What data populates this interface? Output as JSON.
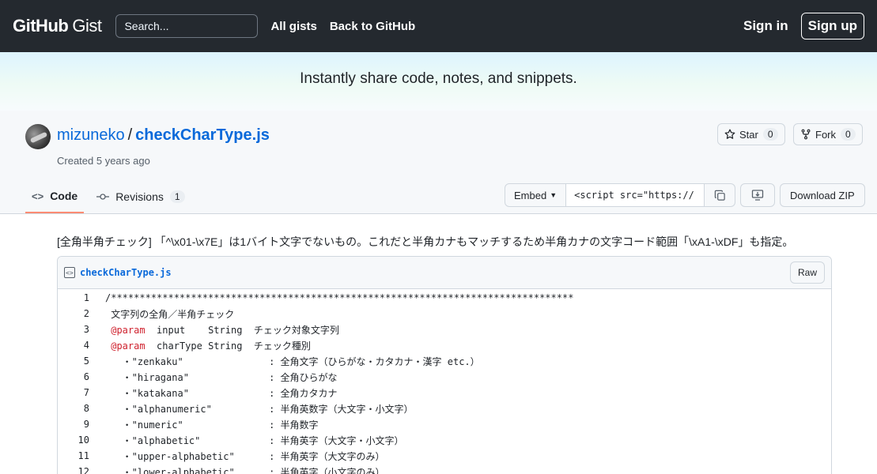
{
  "header": {
    "logo_main": "GitHub",
    "logo_sub": "Gist",
    "search_placeholder": "Search...",
    "nav": [
      "All gists",
      "Back to GitHub"
    ],
    "signin": "Sign in",
    "signup": "Sign up"
  },
  "hero": {
    "text": "Instantly share code, notes, and snippets."
  },
  "gist": {
    "owner": "mizuneko",
    "separator": "/",
    "filename": "checkCharType.js",
    "created": "Created 5 years ago",
    "star_label": "Star",
    "star_count": "0",
    "fork_label": "Fork",
    "fork_count": "0"
  },
  "tabs": {
    "code": "Code",
    "revisions": "Revisions",
    "revisions_count": "1"
  },
  "toolbar": {
    "embed_label": "Embed",
    "embed_value": "<script src=\"https://",
    "download": "Download ZIP"
  },
  "description": "[全角半角チェック] 「^\\x01-\\x7E」は1バイト文字でないもの。これだと半角カナもマッチするため半角カナの文字コード範囲「\\xA1-\\xDF」も指定。",
  "file": {
    "name": "checkCharType.js",
    "raw_label": "Raw",
    "lines": [
      {
        "n": "1",
        "pre": "",
        "tag": "",
        "text": "/*********************************************************************************"
      },
      {
        "n": "2",
        "pre": " ",
        "tag": "",
        "text": "文字列の全角／半角チェック"
      },
      {
        "n": "3",
        "pre": " ",
        "tag": "@param",
        "text": "  input    String  チェック対象文字列"
      },
      {
        "n": "4",
        "pre": " ",
        "tag": "@param",
        "text": "  charType String  チェック種別"
      },
      {
        "n": "5",
        "pre": "",
        "tag": "",
        "text": "   ・\"zenkaku\"               : 全角文字（ひらがな・カタカナ・漢字 etc.）"
      },
      {
        "n": "6",
        "pre": "",
        "tag": "",
        "text": "   ・\"hiragana\"              : 全角ひらがな"
      },
      {
        "n": "7",
        "pre": "",
        "tag": "",
        "text": "   ・\"katakana\"              : 全角カタカナ"
      },
      {
        "n": "8",
        "pre": "",
        "tag": "",
        "text": "   ・\"alphanumeric\"          : 半角英数字（大文字・小文字）"
      },
      {
        "n": "9",
        "pre": "",
        "tag": "",
        "text": "   ・\"numeric\"               : 半角数字"
      },
      {
        "n": "10",
        "pre": "",
        "tag": "",
        "text": "   ・\"alphabetic\"            : 半角英字（大文字・小文字）"
      },
      {
        "n": "11",
        "pre": "",
        "tag": "",
        "text": "   ・\"upper-alphabetic\"      : 半角英字（大文字のみ）"
      },
      {
        "n": "12",
        "pre": "",
        "tag": "",
        "text": "   ・\"lower-alphabetic\"      : 半角英字（小文字のみ）"
      }
    ]
  }
}
